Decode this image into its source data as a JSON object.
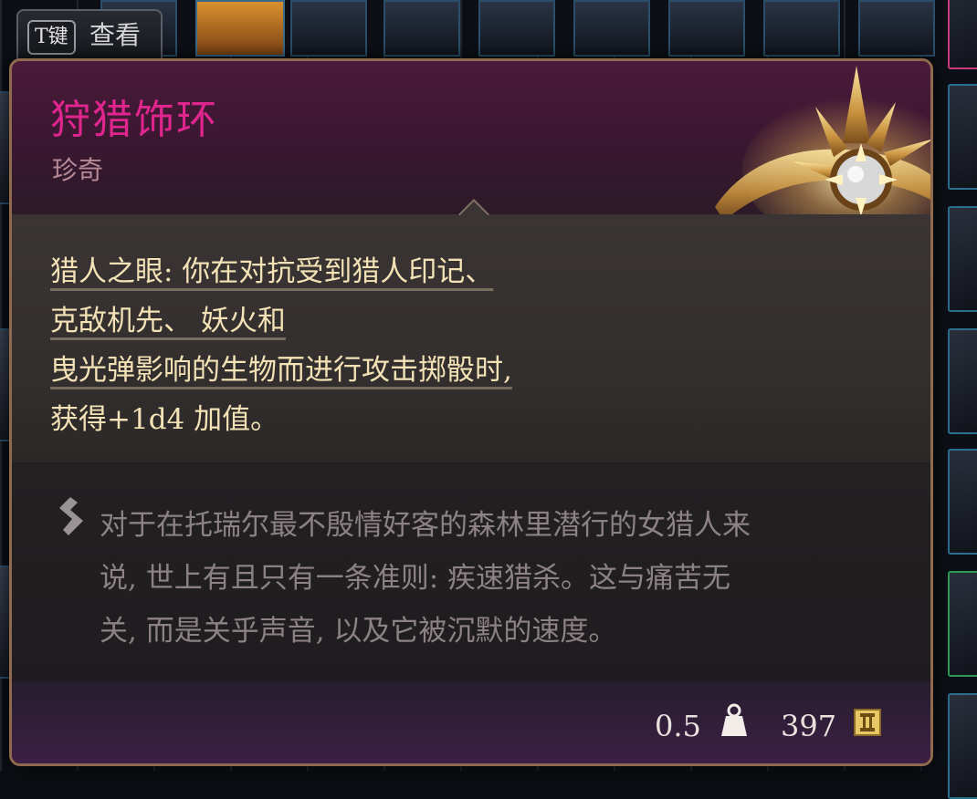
{
  "key_hint": {
    "key": "T键",
    "label": "查看"
  },
  "item": {
    "name": "狩猎饰环",
    "rarity": "珍奇",
    "effect_lines": [
      "猎人之眼: 你在对抗受到猎人印记、",
      "克敌机先、 妖火和",
      "曳光弹影响的生物而进行攻击掷骰时,",
      "获得+1d4 加值。"
    ],
    "flavor_lines": [
      "对于在托瑞尔最不殷情好客的森林里潜行的女猎人来",
      "说, 世上有且只有一条准则: 疾速猎杀。这与痛苦无",
      "关, 而是关乎声音, 以及它被沉默的速度。"
    ],
    "weight": "0.5",
    "price": "397"
  },
  "icons": {
    "item_art": "golden-circlet-icon",
    "flavor": "quote-mark-icon",
    "weight": "weight-icon",
    "price": "gold-coin-icon"
  },
  "colors": {
    "rarity_accent": "#e0268e",
    "effect_text": "#f3e2b5",
    "flavor_text": "#8c8285",
    "frame": "#8f6a4e"
  }
}
